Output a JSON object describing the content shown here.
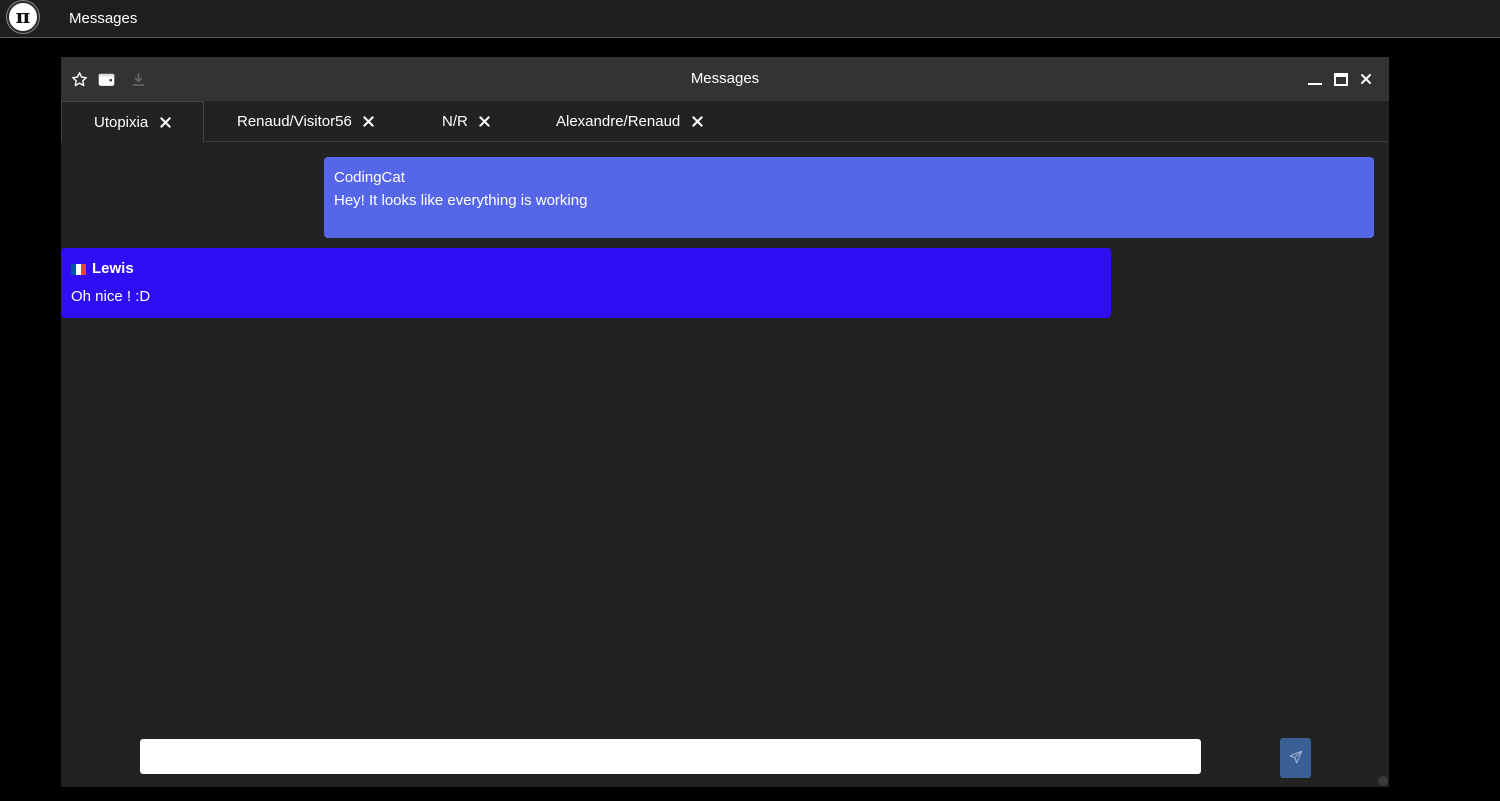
{
  "topbar": {
    "logo_glyph": "π",
    "title": "Messages"
  },
  "window": {
    "title": "Messages",
    "icons": {
      "favorite": "star-icon",
      "wallet": "wallet-icon",
      "download": "download-icon"
    },
    "controls": {
      "minimize": "minimize-icon",
      "maximize": "maximize-icon",
      "close": "close-icon"
    }
  },
  "tabs": [
    {
      "label": "Utopixia",
      "active": true
    },
    {
      "label": "Renaud/Visitor56",
      "active": false
    },
    {
      "label": "N/R",
      "active": false
    },
    {
      "label": "Alexandre/Renaud",
      "active": false
    }
  ],
  "messages": [
    {
      "author": "CodingCat",
      "text": "Hey! It looks like everything is working",
      "own": true
    },
    {
      "author": "Lewis",
      "text": "Oh nice ! :D",
      "own": false,
      "flag": "france-flag-icon"
    }
  ],
  "composer": {
    "value": "",
    "placeholder": ""
  },
  "colors": {
    "own_message": "#5566e8",
    "other_message": "#2f0ef5",
    "send_button": "#3a5f94",
    "window_bg": "#222222",
    "titlebar_bg": "#333333"
  }
}
